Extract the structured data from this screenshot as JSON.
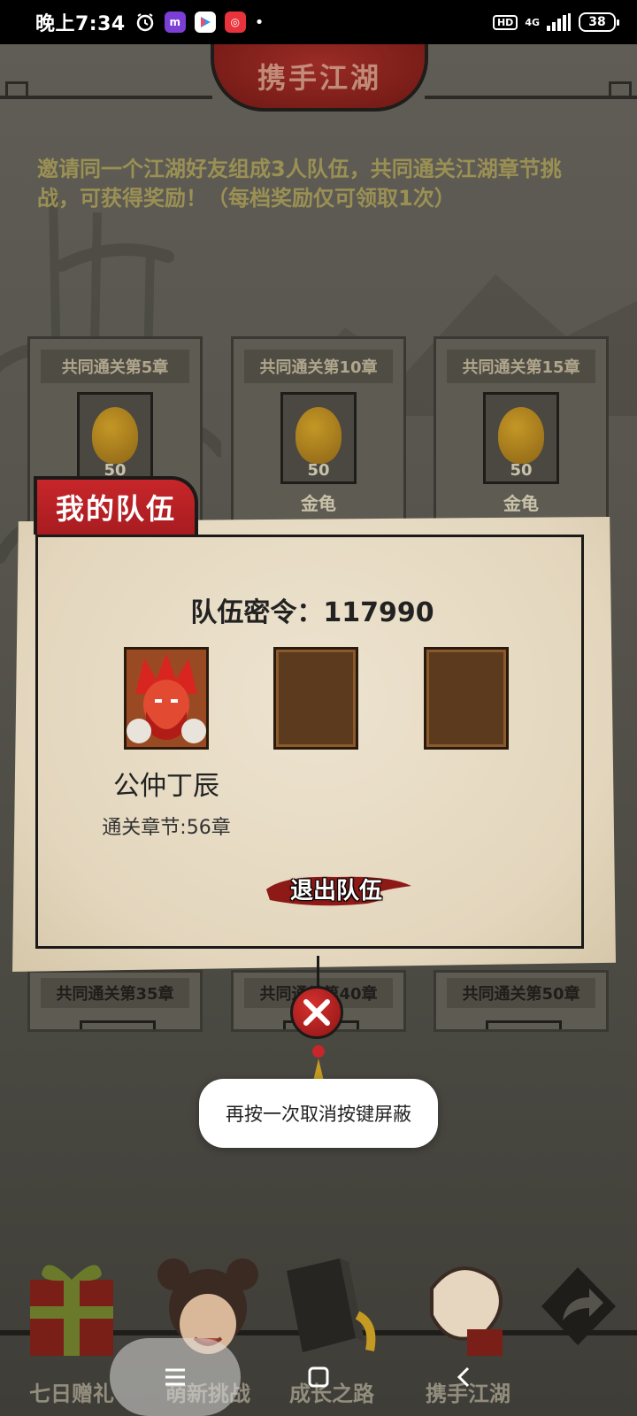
{
  "status_bar": {
    "time": "晚上7:34",
    "hd": "HD",
    "network": "4G",
    "battery": "38"
  },
  "page": {
    "title": "携手江湖",
    "invite_text": "邀请同一个江湖好友组成3人队伍，共同通关江湖章节挑战，可获得奖励！（每档奖励仅可领取1次）"
  },
  "reward_cards": [
    {
      "title": "共同通关第5章",
      "qty": "50",
      "name": ""
    },
    {
      "title": "共同通关第10章",
      "qty": "50",
      "name": "金龟"
    },
    {
      "title": "共同通关第15章",
      "qty": "50",
      "name": "金龟"
    }
  ],
  "reward_cards_lower": [
    {
      "title": "共同通关第35章"
    },
    {
      "title": "共同通关第40章"
    },
    {
      "title": "共同通关第50章"
    }
  ],
  "team_dialog": {
    "tab_title": "我的队伍",
    "code_label": "队伍密令：117990",
    "member": {
      "name": "公仲丁辰",
      "chapter": "通关章节:56章"
    },
    "leave_button": "退出队伍"
  },
  "toast": "再按一次取消按键屏蔽",
  "game_nav": [
    {
      "label": "七日赠礼",
      "icon": "gift-icon"
    },
    {
      "label": "萌新挑战",
      "icon": "girl-avatar-icon"
    },
    {
      "label": "成长之路",
      "icon": "book-icon"
    },
    {
      "label": "携手江湖",
      "icon": "handshake-icon"
    },
    {
      "label": "",
      "icon": "share-arrow-icon"
    }
  ],
  "colors": {
    "accent_red": "#c7262a",
    "panel_paper": "#e9dec8",
    "slot_brown": "#5c3a1e"
  }
}
